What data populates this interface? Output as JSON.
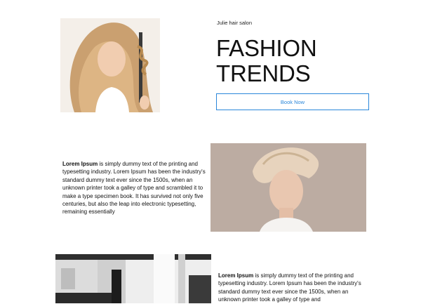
{
  "hero": {
    "brand": "Julie hair salon",
    "headline_line1": "FASHION",
    "headline_line2": "TRENDS",
    "cta_label": "Book Now",
    "accent_color": "#2b87da"
  },
  "section2": {
    "bold_lead": "Lorem Ipsum",
    "body": " is simply dummy text of the printing and typesetting industry. Lorem Ipsum has been the industry's standard dummy text ever since the 1500s, when an unknown printer took a galley of type and scrambled it to make a type specimen book. It has survived not only five centuries, but also the leap into electronic typesetting, remaining essentially"
  },
  "section3": {
    "bold_lead": "Lorem Ipsum",
    "body": " is simply dummy text of the printing and typesetting industry. Lorem Ipsum has been the industry's standard dummy text ever since the 1500s, when an unknown printer took a galley of type and"
  },
  "images": {
    "hero_photo": "woman-curling-hair-photo",
    "portrait_photo": "short-hair-woman-portrait-photo",
    "salon_photo": "salon-interior-photo"
  }
}
